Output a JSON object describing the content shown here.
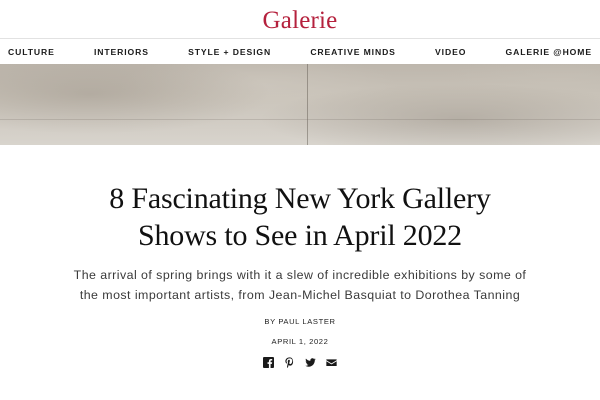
{
  "site": {
    "logo": "Galerie",
    "brand_color": "#b5213d"
  },
  "nav": {
    "items": [
      {
        "label": "CULTURE"
      },
      {
        "label": "INTERIORS"
      },
      {
        "label": "STYLE + DESIGN"
      },
      {
        "label": "CREATIVE MINDS"
      },
      {
        "label": "VIDEO"
      },
      {
        "label": "GALERIE @HOME"
      }
    ]
  },
  "article": {
    "headline_line1": "8 Fascinating New York Gallery",
    "headline_line2": "Shows to See in April 2022",
    "dek_line1": "The arrival of spring brings with it a slew of incredible exhibitions by some of",
    "dek_line2": "the most important artists, from Jean-Michel Basquiat to Dorothea Tanning",
    "byline": "BY PAUL LASTER",
    "date": "APRIL 1, 2022"
  },
  "share": {
    "icons": [
      "facebook-icon",
      "pinterest-icon",
      "twitter-icon",
      "email-icon"
    ]
  }
}
